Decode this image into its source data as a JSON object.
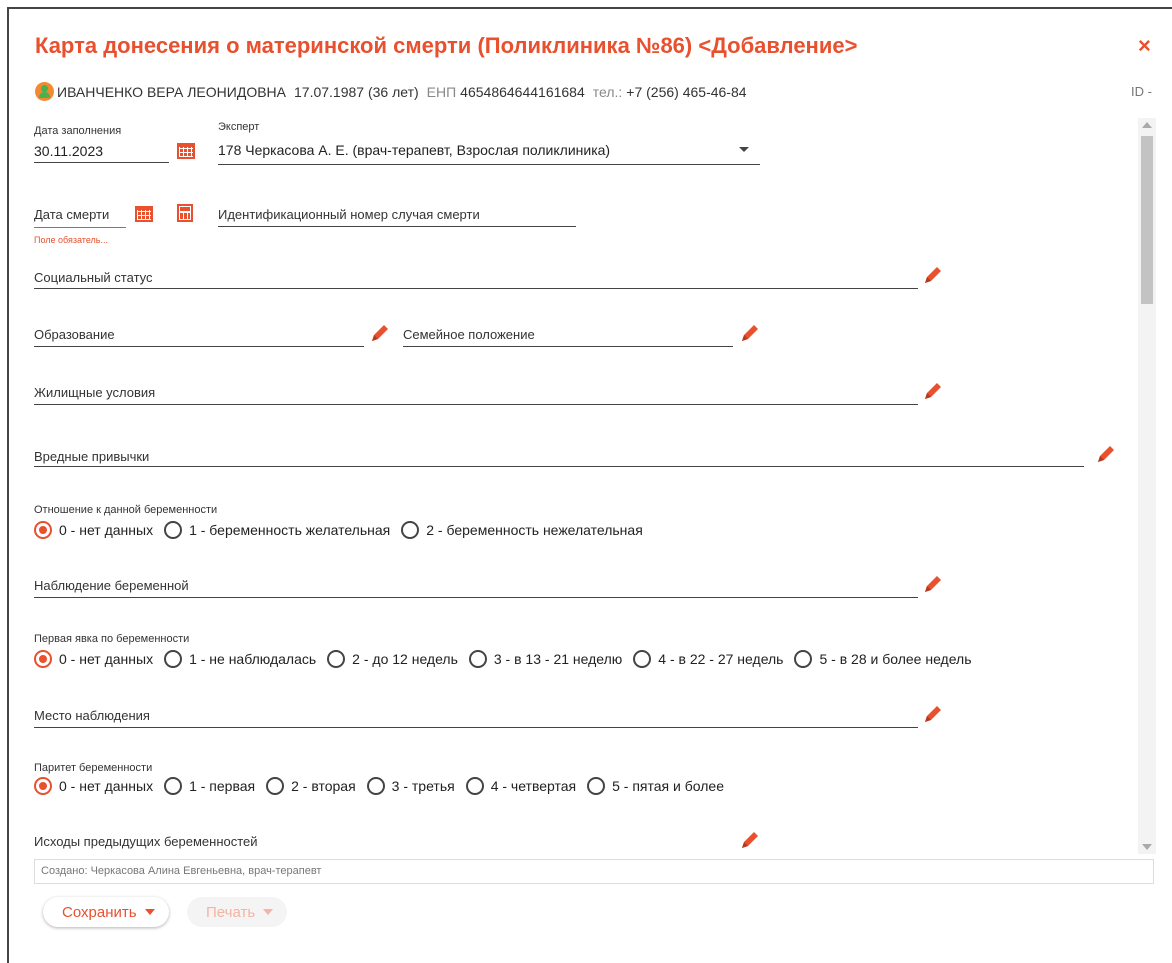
{
  "title": "Карта донесения о материнской смерти (Поликлиника №86) <Добавление>",
  "close_label": "×",
  "patient": {
    "name": "ИВАНЧЕНКО ВЕРА ЛЕОНИДОВНА",
    "birth": "17.07.1987 (36 лет)",
    "enp_label": "ЕНП",
    "enp": "4654864644161684",
    "phone_label": "тел.:",
    "phone": "+7 (256) 465-46-84",
    "id_label": "ID -"
  },
  "form": {
    "fill_date_label": "Дата заполнения",
    "fill_date_value": "30.11.2023",
    "expert_label": "Эксперт",
    "expert_value": "178 Черкасова А. Е.  (врач-терапевт, Взрослая поликлиника)",
    "death_date_label": "Дата смерти",
    "death_date_error": "Поле обязатель...",
    "death_case_id_label": "Идентификационный номер случая смерти",
    "social_status_label": "Социальный статус",
    "education_label": "Образование",
    "marital_status_label": "Семейное положение",
    "housing_label": "Жилищные условия",
    "habits_label": "Вредные привычки",
    "attitude": {
      "label": "Отношение к данной беременности",
      "options": [
        "0 - нет данных",
        "1 - беременность желательная",
        "2 - беременность нежелательная"
      ],
      "selected": "0 - нет данных"
    },
    "observation_label": "Наблюдение беременной",
    "first_visit": {
      "label": "Первая явка по беременности",
      "options": [
        "0 - нет данных",
        "1 - не наблюдалась",
        "2 - до 12 недель",
        "3 - в 13 - 21 неделю",
        "4 - в 22 - 27 недель",
        "5 - в 28 и более недель"
      ],
      "selected": "0 - нет данных"
    },
    "observation_place_label": "Место наблюдения",
    "parity": {
      "label": "Паритет беременности",
      "options": [
        "0 - нет данных",
        "1 - первая",
        "2 - вторая",
        "3 - третья",
        "4 - четвертая",
        "5 - пятая и более"
      ],
      "selected": "0 - нет данных"
    },
    "previous_outcomes_label": "Исходы предыдущих беременностей"
  },
  "created_text": "Создано:  Черкасова Алина Евгеньевна, врач-терапевт",
  "buttons": {
    "save": "Сохранить",
    "print": "Печать"
  },
  "colors": {
    "accent": "#e8502e",
    "disabled": "#f4b3a3"
  },
  "icons": [
    "calendar-icon",
    "calculator-icon",
    "pencil-icon",
    "close-icon",
    "patient-avatar-icon",
    "chevron-down-icon"
  ]
}
